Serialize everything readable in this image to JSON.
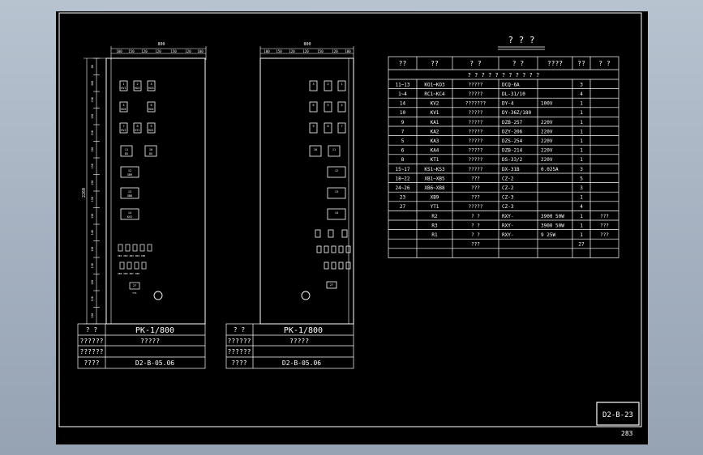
{
  "drawing": {
    "code": "D2-B-23",
    "page_number": "283",
    "table_title": "? ? ?",
    "table_header": [
      "??",
      "??",
      "? ?",
      "? ?",
      "????",
      "??",
      "? ?"
    ],
    "table_subheader": "? ? ? ? ? ? ? ? ? ? ?",
    "table_rows": [
      [
        "11~13",
        "KO1~KO3",
        "?????",
        "DCQ-6A",
        "",
        "3",
        ""
      ],
      [
        "1~4",
        "RC1~KC4",
        "?????",
        "DL-31/10",
        "",
        "4",
        ""
      ],
      [
        "14",
        "KV2",
        "???????",
        "DY-4",
        "100V",
        "1",
        ""
      ],
      [
        "10",
        "KV1",
        "?????",
        "DY-36Z/180",
        "",
        "1",
        ""
      ],
      [
        "9",
        "KA1",
        "?????",
        "DZB-257",
        "220V",
        "1",
        ""
      ],
      [
        "7",
        "KA2",
        "?????",
        "DZY-206",
        "220V",
        "1",
        ""
      ],
      [
        "5",
        "KA3",
        "?????",
        "DZS-254",
        "220V",
        "1",
        ""
      ],
      [
        "6",
        "KA4",
        "?????",
        "DZB-214",
        "220V",
        "1",
        ""
      ],
      [
        "8",
        "KT1",
        "?????",
        "DS-33/2",
        "220V",
        "1",
        ""
      ],
      [
        "15~17",
        "KS1~KS3",
        "?????",
        "DX-31B",
        "0.025A",
        "3",
        ""
      ],
      [
        "18~22",
        "XB1~XB5",
        "???",
        "CZ-2",
        "",
        "5",
        ""
      ],
      [
        "24~26",
        "XB6~XB8",
        "???",
        "CZ-2",
        "",
        "3",
        ""
      ],
      [
        "23",
        "XB9",
        "???",
        "CZ-3",
        "",
        "1",
        ""
      ],
      [
        "27",
        "YT1",
        "?????",
        "CZ-3",
        "",
        "4",
        ""
      ],
      [
        "",
        "R2",
        "? ?",
        "RXY-",
        "3900  50W",
        "1",
        "???"
      ],
      [
        "",
        "R3",
        "? ?",
        "RXY-",
        "3900  50W",
        "1",
        "???"
      ],
      [
        "",
        "R1",
        "? ?",
        "RXY-",
        "9    25W",
        "1",
        "???"
      ],
      [
        "",
        "",
        "???",
        "",
        "",
        "27",
        ""
      ],
      [
        "",
        "",
        "",
        "",
        "",
        "",
        ""
      ]
    ],
    "panels": [
      {
        "width_label": "800",
        "dims": [
          "100",
          "150",
          "120",
          "120",
          "150",
          "120",
          "100"
        ],
        "height_label": "2260",
        "vdims": [
          "80",
          "200",
          "230",
          "150",
          "150",
          "150",
          "150",
          "150",
          "150",
          "150",
          "140",
          "130",
          "130",
          "150",
          "120",
          "330"
        ],
        "title_block": {
          "r1c1": "? ?",
          "r1c2": "PK-1/800",
          "r2c1": "??????",
          "r2c2": "?????",
          "r3c1": "??????",
          "r3c2": "",
          "r4c1": "????",
          "r4c2": "D2-B-05.06"
        },
        "device_labels": {
          "d1": "KV1",
          "d2": "KO2",
          "d3": "KO3",
          "d4": "KO4",
          "d5": "KO3",
          "d6": "KO4",
          "d7": "KV1",
          "d8": "KT1",
          "d9": "KO1",
          "d11": "DX",
          "d10": "DX",
          "d12": "XB9",
          "d13": "XB8",
          "d14": "KV2",
          "dr": "XB1 XB2 XB3 XB4 XB5",
          "dr2": "XB6 XB6 XB7 XB8",
          "d27": "YT1"
        }
      },
      {
        "width_label": "800",
        "dims": [
          "100",
          "150",
          "120",
          "120",
          "150",
          "120",
          "100"
        ],
        "title_block": {
          "r1c1": "? ?",
          "r1c2": "PK-1/800",
          "r2c1": "??????",
          "r2c2": "?????",
          "r3c1": "??????",
          "r3c2": "",
          "r4c1": "????",
          "r4c2": "D2-B-05.06"
        }
      }
    ]
  }
}
